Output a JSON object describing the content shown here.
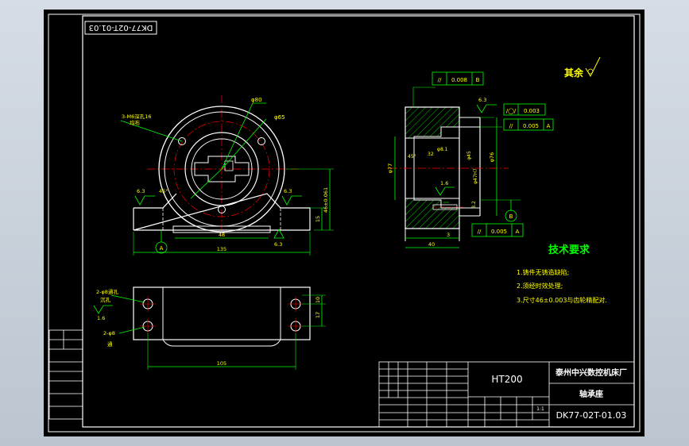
{
  "viewer": {
    "background_color": "#c9d1db",
    "paper_color": "#000000"
  },
  "colors": {
    "frame": "#ffffff",
    "outline": "#ffffff",
    "dimension": "#00ff00",
    "centerline": "#ff0000",
    "hatch": "#00ff00",
    "text_yellow": "#ffff00",
    "text_green": "#00ff00",
    "text_white": "#ffffff"
  },
  "drawing": {
    "rotated_code": "DK77-02T-01.03",
    "roughness_note": "其余",
    "front_view": {
      "hole_note_line1": "3-M6深孔16",
      "hole_note_line2": "均布",
      "dim_diameter_outer": "φ80",
      "dim_diameter_bolt": "φ65",
      "dim_height": "46±0.061",
      "dim_rough_left": "6.3",
      "dim_rough_right": "6.3",
      "dim_angle": "45°",
      "dim_base_height": "15",
      "dim_base_width": "48",
      "dim_total_width": "135",
      "datum_label": "A",
      "rough_bottom": "6.3"
    },
    "side_view": {
      "gdt_top_symbol": "//",
      "gdt_top_value": "0.008",
      "gdt_top_datum": "B",
      "rough_top": "6.3",
      "gdt_right1_symbol": "/◯/",
      "gdt_right1_value": "0.003",
      "gdt_right2_symbol": "//",
      "gdt_right2_value": "0.005",
      "gdt_right2_datum": "A",
      "dim_left_dia": "φ77",
      "dim_inner_1": "32",
      "dim_inner_2": "φ8.1",
      "dim_inner_3": "φ45",
      "dim_inner_4": "φ47H7",
      "dim_right_dia": "φ76",
      "dim_angle_side": "45°",
      "rough_inner": "1.6",
      "dim_small": "3.2",
      "dim_step": "3",
      "gdt_bottom_symbol": "//",
      "gdt_bottom_value": "0.005",
      "gdt_bottom_datum": "A",
      "datum_b": "B",
      "dim_width": "40"
    },
    "top_view": {
      "hole_note_1a": "2-φ8通孔",
      "hole_note_1b": "沉孔",
      "rough_value": "1.6",
      "hole_note_2a": "2-φ8",
      "hole_note_2b": "通",
      "dim_right_1": "10",
      "dim_right_2": "17",
      "dim_length": "105"
    },
    "tech_requirements": {
      "heading": "技术要求",
      "items": [
        "1.铸件无铸造缺陷;",
        "2.须经时效处理;",
        "3.尺寸46±0.003与齿轮精配对."
      ]
    },
    "title_block": {
      "material": "HT200",
      "company": "泰州中兴数控机床厂",
      "part_name": "轴承座",
      "drawing_no": "DK77-02T-01.03",
      "scale": "1:1"
    }
  }
}
